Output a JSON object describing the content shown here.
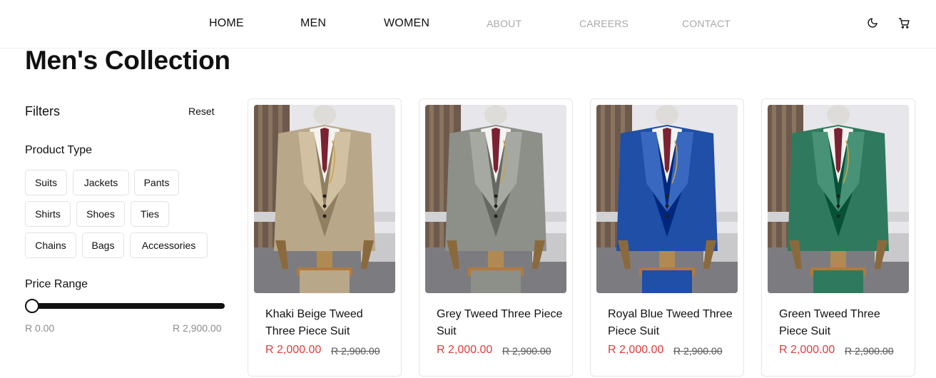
{
  "nav": {
    "items": [
      {
        "label": "HOME",
        "active": true
      },
      {
        "label": "MEN",
        "active": true
      },
      {
        "label": "WOMEN",
        "active": true
      },
      {
        "label": "ABOUT",
        "active": false
      },
      {
        "label": "CAREERS",
        "active": false
      },
      {
        "label": "CONTACT",
        "active": false
      }
    ],
    "icons": [
      "moon-icon",
      "cart-icon"
    ]
  },
  "page": {
    "title": "Men's Collection"
  },
  "filters": {
    "title": "Filters",
    "reset_label": "Reset",
    "product_type_label": "Product Type",
    "product_types": [
      "Suits",
      "Jackets",
      "Pants",
      "Shirts",
      "Shoes",
      "Ties",
      "Chains",
      "Bags",
      "Accessories"
    ],
    "price_range_label": "Price Range",
    "price_min": "R 0.00",
    "price_max": "R 2,900.00",
    "slider_value_fraction": 0.0
  },
  "products": [
    {
      "name": "Khaki Beige Tweed Three Piece Suit",
      "price": "R 2,000.00",
      "old_price": "R 2,900.00",
      "suit_color": "#b9a789"
    },
    {
      "name": "Grey Tweed Three Piece Suit",
      "price": "R 2,000.00",
      "old_price": "R 2,900.00",
      "suit_color": "#8d8f89"
    },
    {
      "name": "Royal Blue Tweed Three Piece Suit",
      "price": "R 2,000.00",
      "old_price": "R 2,900.00",
      "suit_color": "#1f4fa6"
    },
    {
      "name": "Green Tweed Three Piece Suit",
      "price": "R 2,000.00",
      "old_price": "R 2,900.00",
      "suit_color": "#2f7a5e"
    }
  ],
  "colors": {
    "sale_price": "#e23c3c",
    "muted_nav": "#a9a9a9",
    "text": "#111111"
  }
}
